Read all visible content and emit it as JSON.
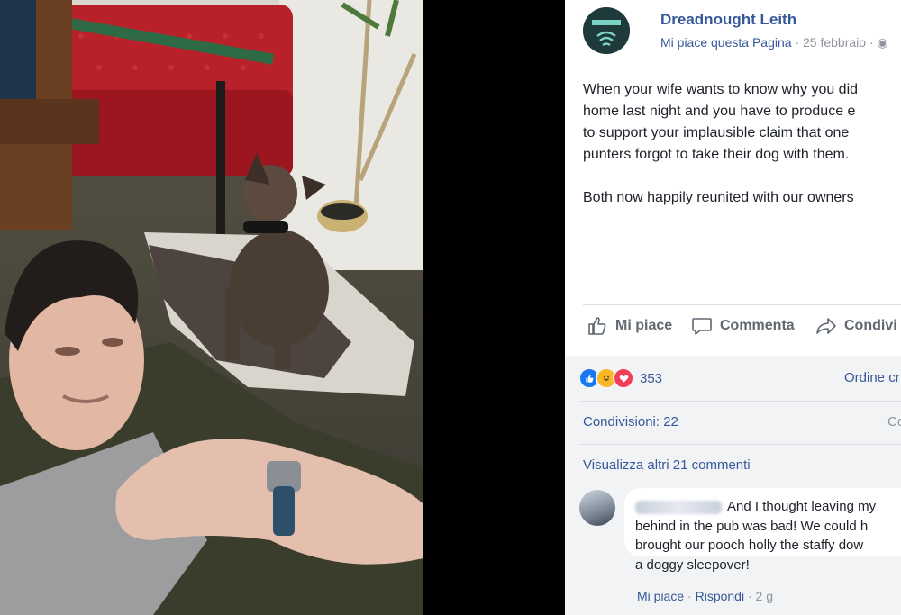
{
  "post": {
    "page_name": "Dreadnought Leith",
    "like_page": "Mi piace questa Pagina",
    "date": "25 febbraio",
    "separator": "·",
    "body": [
      "When your wife wants to know why you did\nhome last night and you have to produce e\nto support your implausible claim that one \npunters forgot to take their dog with them.",
      "Both now happily reunited with our owners"
    ],
    "actions": {
      "like": "Mi piace",
      "comment": "Commenta",
      "share": "Condivi"
    }
  },
  "engagement": {
    "reaction_count": "353",
    "order": "Ordine cr",
    "shares": "Condivisioni: 22",
    "shares_right": "Co",
    "more_comments": "Visualizza altri 21 commenti"
  },
  "comment": {
    "line1": "And I thought leaving my",
    "line2": "behind in the pub was bad! We could h",
    "line3": "brought our pooch holly the staffy dow",
    "line4": "a doggy sleepover!",
    "like": "Mi piace",
    "reply": "Rispondi",
    "sep": "·",
    "age": "2 g"
  },
  "colors": {
    "link": "#365899",
    "muted": "#90949c",
    "text": "#1d2129",
    "like_blue": "#1877f2",
    "haha_yellow": "#f7b928",
    "love_red": "#f33e58"
  }
}
